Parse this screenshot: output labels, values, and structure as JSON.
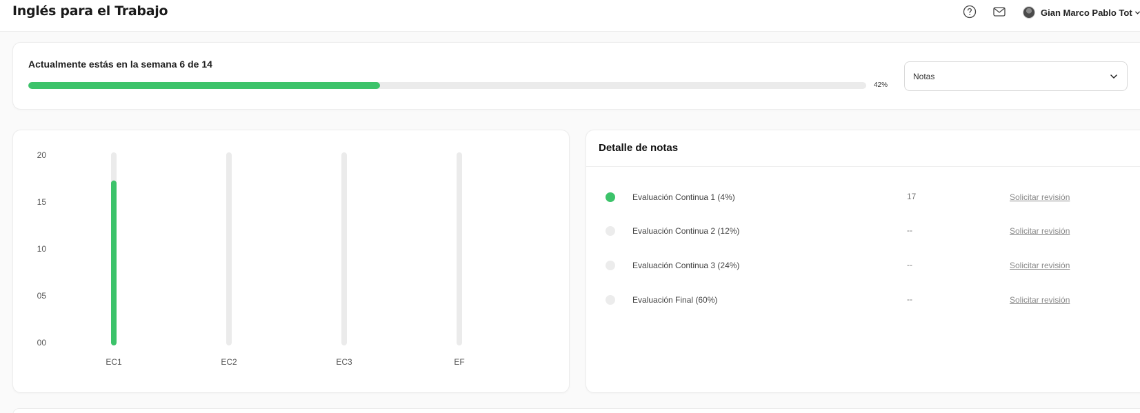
{
  "header": {
    "title": "Inglés para el Trabajo",
    "help_icon": "help-circle-icon",
    "mail_icon": "mail-icon",
    "user_name": "Gian Marco Pablo Tot",
    "user_chevron_icon": "chevron-down-icon"
  },
  "progress": {
    "text": "Actualmente estás en la semana 6 de 14",
    "percent_label": "42%",
    "percent_value": 42,
    "fill_color": "#3cc36a",
    "track_color": "#ebebeb"
  },
  "view_select": {
    "selected": "Notas",
    "icon": "chevron-down-icon"
  },
  "chart_data": {
    "type": "bar",
    "categories": [
      "EC1",
      "EC2",
      "EC3",
      "EF"
    ],
    "values": [
      17,
      null,
      null,
      null
    ],
    "ylim": [
      0,
      20
    ],
    "yticks": [
      "00",
      "05",
      "10",
      "15",
      "20"
    ],
    "ytick_values": [
      0,
      5,
      10,
      15,
      20
    ],
    "bar_color": "#3cc36a",
    "track_color": "#ebebeb",
    "grid": false
  },
  "detail": {
    "title": "Detalle de notas",
    "rows": [
      {
        "name": "Evaluación Continua 1 (4%)",
        "score": "17",
        "link": "Solicitar revisión",
        "dot_color": "#3cc36a"
      },
      {
        "name": "Evaluación Continua 2 (12%)",
        "score": "--",
        "link": "Solicitar revisión",
        "dot_color": "#ececec"
      },
      {
        "name": "Evaluación Continua 3 (24%)",
        "score": "--",
        "link": "Solicitar revisión",
        "dot_color": "#ececec"
      },
      {
        "name": "Evaluación Final (60%)",
        "score": "--",
        "link": "Solicitar revisión",
        "dot_color": "#ececec"
      }
    ]
  }
}
